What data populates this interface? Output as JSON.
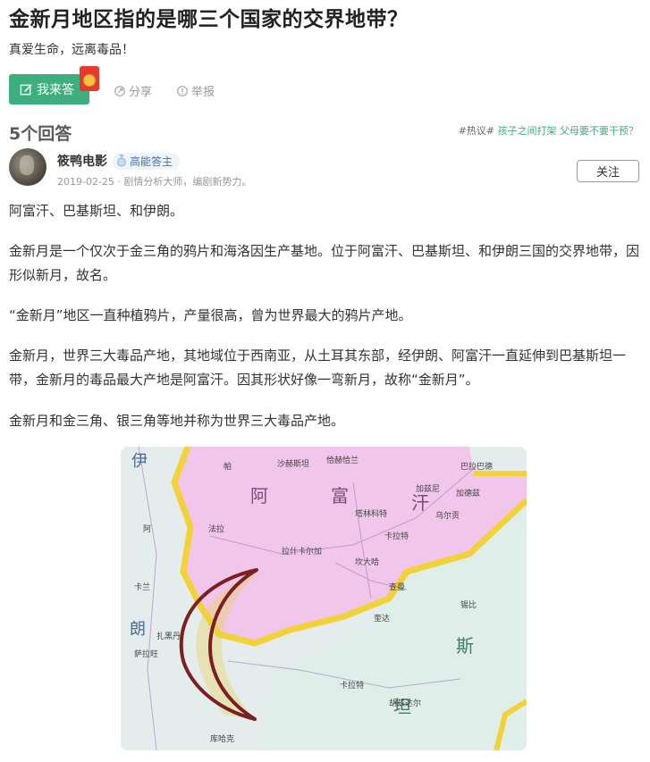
{
  "question": {
    "title": "金新月地区指的是哪三个国家的交界地带？",
    "subtitle": "真爱生命，远离毒品！"
  },
  "actions": {
    "answer_label": "我来答",
    "share_label": "分享",
    "report_label": "举报"
  },
  "answers_header": {
    "count_label": "5个回答",
    "hot_tag": "#热议#",
    "hot_topic": "孩子之间打架 父母要不要干预？"
  },
  "answer": {
    "author": "筱鸭电影",
    "badge": "高能答主",
    "meta": "2019-02-25 · 剧情分析大师，编剧新势力。",
    "follow_label": "关注",
    "paragraphs": [
      "阿富汗、巴基斯坦、和伊朗。",
      "金新月是一个仅次于金三角的鸦片和海洛因生产基地。位于阿富汗、巴基斯坦、和伊朗三国的交界地带，因形似新月，故名。",
      "“金新月”地区一直种植鸦片，产量很高，曾为世界最大的鸦片产地。",
      "金新月，世界三大毒品产地，其地域位于西南亚，从土耳其东部，经伊朗、阿富汗一直延伸到巴基斯坦一带，金新月的毒品最大产地是阿富汗。因其形状好像一弯新月，故称“金新月”。",
      "金新月和金三角、银三角等地并称为世界三大毒品产地。"
    ]
  },
  "map": {
    "country_labels": [
      "伊",
      "朗",
      "阿",
      "富",
      "汗",
      "斯",
      "坦"
    ],
    "places": [
      "帕",
      "沙赫斯坦",
      "恰赫恰兰",
      "加兹尼",
      "巴拉巴德",
      "加德兹",
      "法拉",
      "阿",
      "塔林科特",
      "乌尔贡",
      "卡拉特",
      "拉什卡尔加",
      "坎大哈",
      "扎黑丹",
      "查曼",
      "奎达",
      "锡比",
      "胡兹达尔",
      "卡拉特",
      "库哈克",
      "萨拉旺",
      "卡兰"
    ],
    "colors": {
      "afghanistan": "#f1c6ea",
      "iran": "#e4ecec",
      "pakistan": "#dfeee9",
      "border": "#f2d23a",
      "crescent": "#7a1f22"
    }
  }
}
